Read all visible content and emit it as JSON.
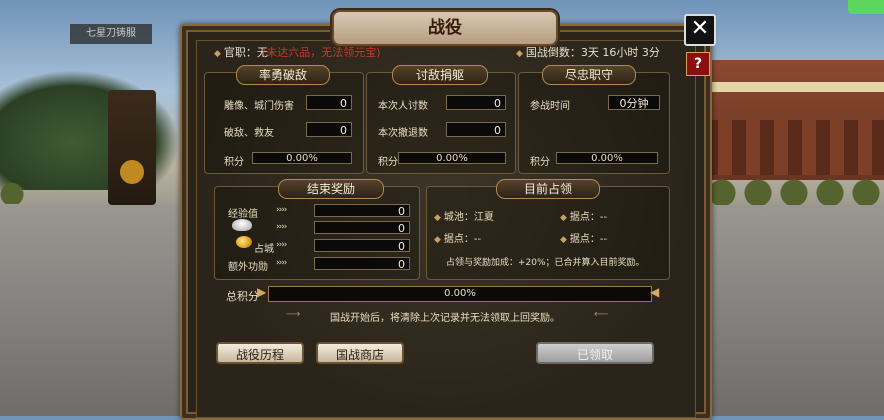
{
  "background": {
    "sign_text": "七星刀铸服"
  },
  "dialog": {
    "title": "战役",
    "close_icon": "✕",
    "help_icon": "?",
    "rank_label": "官职：无",
    "rank_note": "(未达六品，无法领元宝)",
    "countdown": "国战倒数：3天 16小时 3分"
  },
  "panels": {
    "brave": {
      "title": "率勇破敌",
      "rows": [
        {
          "label": "雕像、城门伤害",
          "value": "0"
        },
        {
          "label": "破敌、救友",
          "value": "0"
        }
      ],
      "score_label": "积分",
      "score_value": "0.00%"
    },
    "hunt": {
      "title": "讨敌捐躯",
      "rows": [
        {
          "label": "本次人讨数",
          "value": "0"
        },
        {
          "label": "本次撤退数",
          "value": "0"
        }
      ],
      "score_label": "积分",
      "score_value": "0.00%"
    },
    "duty": {
      "title": "尽忠职守",
      "rows": [
        {
          "label": "参战时间",
          "value": "0分钟"
        }
      ],
      "score_label": "积分",
      "score_value": "0.00%"
    },
    "rewards": {
      "title": "结束奖励",
      "arrows": "››››",
      "rows": [
        {
          "label": "经验值",
          "value": "0"
        },
        {
          "label": "",
          "value": "0"
        },
        {
          "label": "占城",
          "value": "0"
        },
        {
          "label": "额外功勋",
          "value": "0"
        }
      ]
    },
    "occupy": {
      "title": "目前占领",
      "city": "城池：江夏",
      "stronghold_1": "据点：--",
      "stronghold_2": "据点：--",
      "stronghold_3": "据点：--",
      "bonus_note": "占领与奖励加成：+20%；已合并算入目前奖励。"
    }
  },
  "total": {
    "label": "总积分",
    "value": "0.00%",
    "notice": "国战开始后，将清除上次记录并无法领取上回奖励。"
  },
  "buttons": {
    "history": "战役历程",
    "shop": "国战商店",
    "claimed": "已领取"
  },
  "colors": {
    "accent_red": "#c83a2a",
    "gold": "#b08a50"
  }
}
